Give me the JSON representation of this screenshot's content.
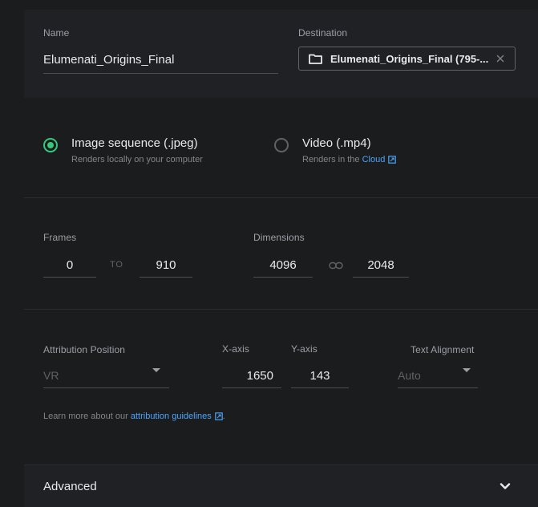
{
  "output": {
    "name_label": "Name",
    "name_value": "Elumenati_Origins_Final",
    "destination_label": "Destination",
    "destination_value": "Elumenati_Origins_Final (795-...",
    "destination_icon": "folder-icon",
    "clear_icon": "close-icon"
  },
  "render_type": {
    "options": [
      {
        "title": "Image sequence (.jpeg)",
        "subtitle": "Renders locally on your computer",
        "selected": true
      },
      {
        "title": "Video (.mp4)",
        "subtitle_prefix": "Renders in the",
        "subtitle_link": "Cloud",
        "selected": false
      }
    ],
    "accent_color": "#34c97b",
    "link_color": "#4fa3f7"
  },
  "frames": {
    "label": "Frames",
    "start": "0",
    "to_label": "TO",
    "end": "910"
  },
  "dimensions": {
    "label": "Dimensions",
    "width": "4096",
    "height": "2048",
    "link_icon": "link-icon"
  },
  "attribution": {
    "position_label": "Attribution Position",
    "position_value": "VR",
    "x_label": "X-axis",
    "x_value": "1650",
    "y_label": "Y-axis",
    "y_value": "143",
    "alignment_label": "Text Alignment",
    "alignment_value": "Auto",
    "learn_prefix": "Learn more about our",
    "learn_link": "attribution guidelines",
    "learn_suffix": "."
  },
  "advanced": {
    "label": "Advanced",
    "icon": "chevron-down-icon"
  }
}
